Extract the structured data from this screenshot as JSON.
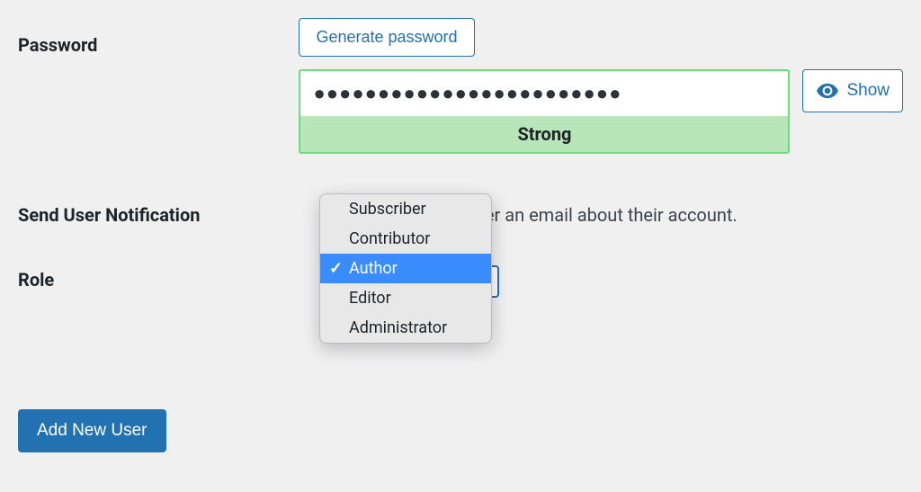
{
  "password": {
    "label": "Password",
    "generate_button": "Generate password",
    "value": "●●●●●●●●●●●●●●●●●●●●●●●●",
    "strength_text": "Strong",
    "show_button": "Show"
  },
  "notification": {
    "label": "Send User Notification",
    "checkbox_checked": true,
    "text": "Send the new user an email about their account."
  },
  "role": {
    "label": "Role",
    "options": [
      "Subscriber",
      "Contributor",
      "Author",
      "Editor",
      "Administrator"
    ],
    "selected": "Author"
  },
  "submit": {
    "label": "Add New User"
  }
}
